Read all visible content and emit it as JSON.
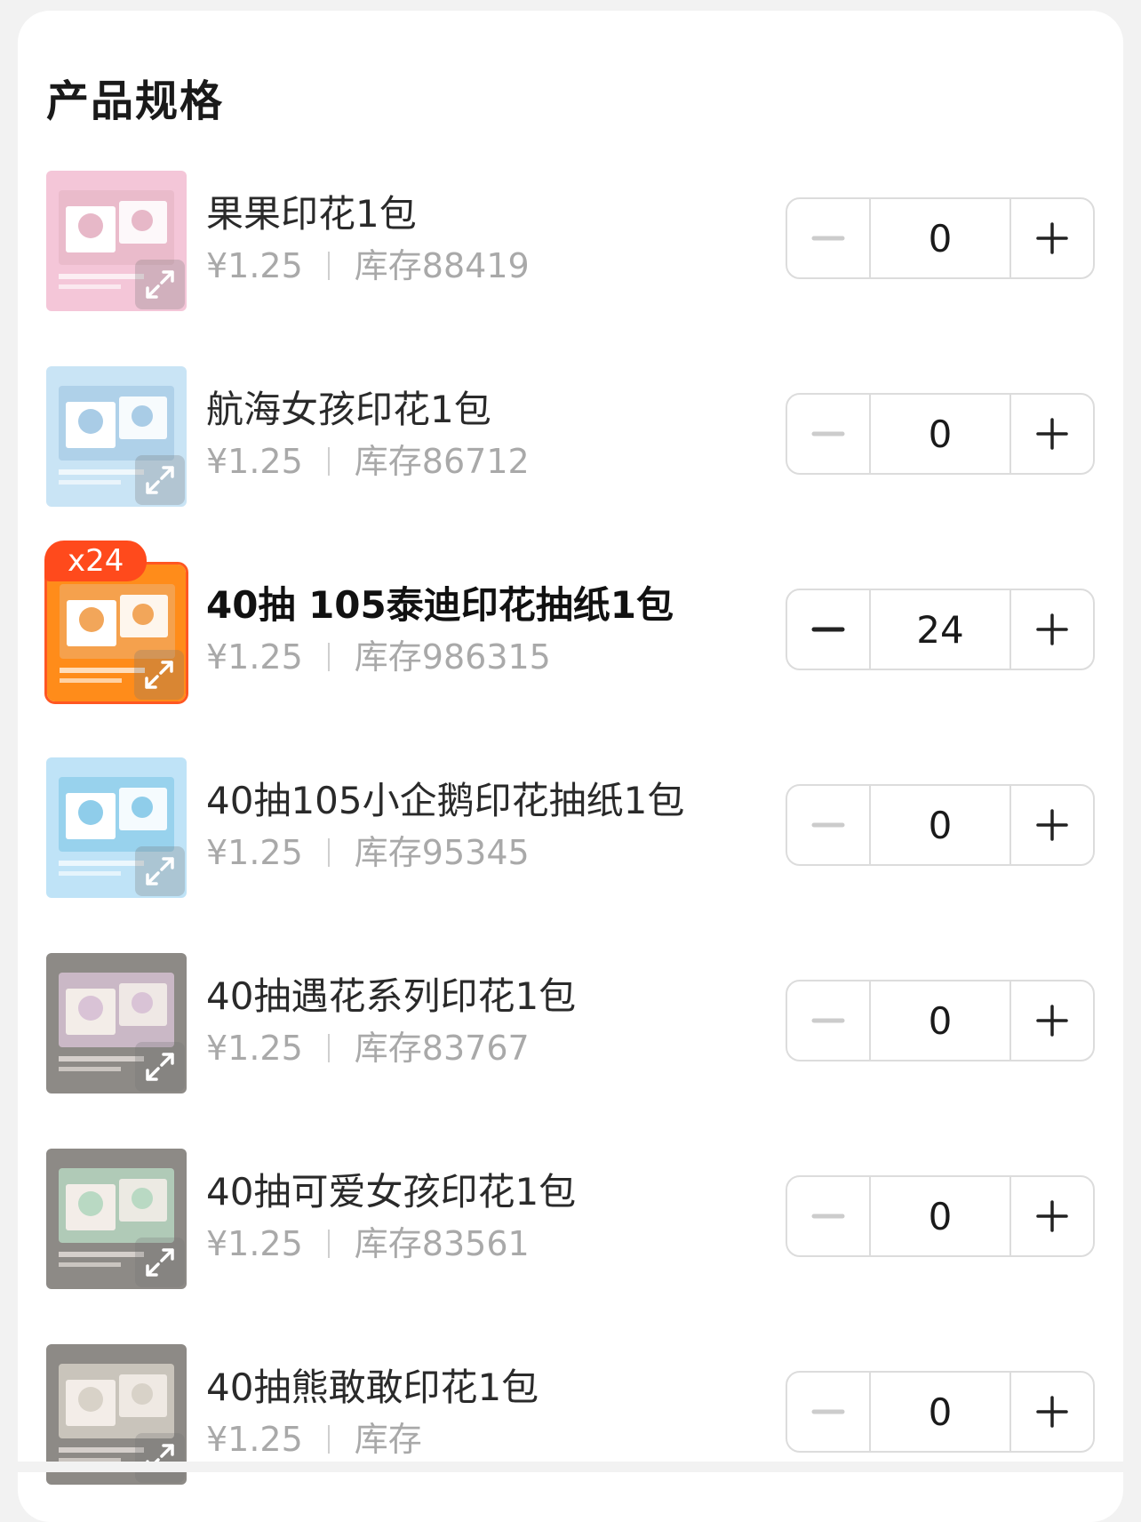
{
  "section": {
    "title": "产品规格"
  },
  "currency_prefix": "¥",
  "stock_prefix": "库存",
  "items": [
    {
      "name": "果果印花1包",
      "price": "¥1.25",
      "stock": "库存88419",
      "quantity": "0",
      "selected": false,
      "badge": "",
      "thumb_colors": [
        "#f4c6d8",
        "#ffffff",
        "#e7b8c8"
      ]
    },
    {
      "name": "航海女孩印花1包",
      "price": "¥1.25",
      "stock": "库存86712",
      "quantity": "0",
      "selected": false,
      "badge": "",
      "thumb_colors": [
        "#c9e4f5",
        "#ffffff",
        "#a9cce6"
      ]
    },
    {
      "name": "40抽  105泰迪印花抽纸1包",
      "price": "¥1.25",
      "stock": "库存986315",
      "quantity": "24",
      "selected": true,
      "badge": "x24",
      "thumb_colors": [
        "#ff8c1a",
        "#ffffff",
        "#f2a65a"
      ]
    },
    {
      "name": "40抽105小企鹅印花抽纸1包",
      "price": "¥1.25",
      "stock": "库存95345",
      "quantity": "0",
      "selected": false,
      "badge": "",
      "thumb_colors": [
        "#bfe3f7",
        "#ffffff",
        "#8fcdea"
      ]
    },
    {
      "name": "40抽遇花系列印花1包",
      "price": "¥1.25",
      "stock": "库存83767",
      "quantity": "0",
      "selected": false,
      "badge": "",
      "thumb_colors": [
        "#8d8a86",
        "#f3ede8",
        "#d9c3d6"
      ]
    },
    {
      "name": "40抽可爱女孩印花1包",
      "price": "¥1.25",
      "stock": "库存83561",
      "quantity": "0",
      "selected": false,
      "badge": "",
      "thumb_colors": [
        "#8d8a86",
        "#f3ede8",
        "#b9d9c3"
      ]
    },
    {
      "name": "40抽熊敢敢印花1包",
      "price": "¥1.25",
      "stock": "库存",
      "quantity": "0",
      "selected": false,
      "badge": "",
      "thumb_colors": [
        "#8d8a86",
        "#f3ede8",
        "#d8d2c8"
      ]
    }
  ],
  "icons": {
    "minus": "minus-icon",
    "plus": "plus-icon",
    "expand": "expand-icon"
  },
  "colors": {
    "accent": "#ff4a1c",
    "muted_text": "#a9a9a9",
    "border": "#dcdcdc",
    "disabled_minus": "#cccccc",
    "active_minus": "#222222"
  }
}
